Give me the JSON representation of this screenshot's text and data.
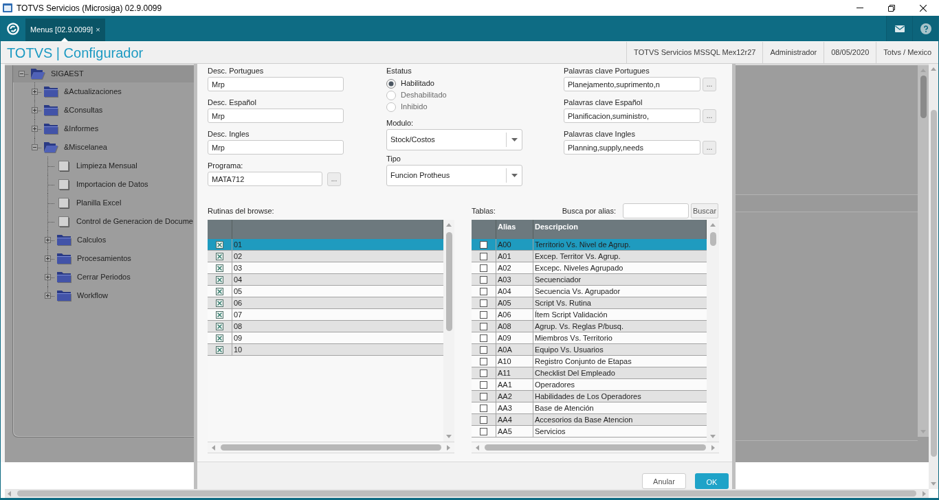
{
  "window": {
    "title": "TOTVS Servicios (Microsiga) 02.9.0099"
  },
  "tabs": [
    {
      "label": "Menus [02.9.0099]",
      "close": "×",
      "selected": true
    }
  ],
  "header": {
    "title": "TOTVS | Configurador",
    "info": [
      "TOTVS Servicios MSSQL Mex12r27",
      "Administrador",
      "08/05/2020",
      "Totvs / Mexico"
    ]
  },
  "menu_tree": [
    {
      "label": "SIGAEST",
      "kind": "folder",
      "expanded": true,
      "selected": true,
      "children": [
        {
          "label": "&Actualizaciones",
          "kind": "folder",
          "expanded": false,
          "selected": false
        },
        {
          "label": "&Consultas",
          "kind": "folder",
          "expanded": false,
          "selected": false
        },
        {
          "label": "&Informes",
          "kind": "folder",
          "expanded": false,
          "selected": false
        },
        {
          "label": "&Miscelanea",
          "kind": "folder",
          "expanded": true,
          "selected": false,
          "children": [
            {
              "label": "Limpieza Mensual",
              "kind": "item",
              "selected": false
            },
            {
              "label": "Importacion de Datos",
              "kind": "item",
              "selected": false
            },
            {
              "label": "Planilla Excel",
              "kind": "item",
              "selected": false
            },
            {
              "label": "Control de Generacion de Docume",
              "kind": "item",
              "selected": false
            },
            {
              "label": "Calculos",
              "kind": "folder",
              "expanded": false,
              "selected": false
            },
            {
              "label": "Procesamientos",
              "kind": "folder",
              "expanded": false,
              "selected": false
            },
            {
              "label": "Cerrar Periodos",
              "kind": "folder",
              "expanded": false,
              "selected": false
            },
            {
              "label": "Workflow",
              "kind": "folder",
              "expanded": false,
              "selected": false
            }
          ]
        }
      ]
    }
  ],
  "dialog": {
    "descriptions": [
      {
        "label": "Desc. Portugues",
        "value": "Mrp"
      },
      {
        "label": "Desc. Español",
        "value": "Mrp"
      },
      {
        "label": "Desc. Ingles",
        "value": "Mrp"
      }
    ],
    "program": {
      "label": "Programa:",
      "value": "MATA712",
      "button": "..."
    },
    "status": {
      "label": "Estatus",
      "options": [
        {
          "label": "Habilitado",
          "selected": true
        },
        {
          "label": "Deshabilitado",
          "selected": false
        },
        {
          "label": "Inhibido",
          "selected": false
        }
      ]
    },
    "module": {
      "label": "Modulo:",
      "value": "Stock/Costos"
    },
    "type": {
      "label": "Tipo",
      "value": "Funcion Protheus"
    },
    "keywords": [
      {
        "label": "Palavras clave Portugues",
        "value": "Planejamento,suprimento,n",
        "button": "..."
      },
      {
        "label": "Palavras clave Español",
        "value": "Planificacion,suministro,",
        "button": "..."
      },
      {
        "label": "Palavras clave Ingles",
        "value": "Planning,supply,needs",
        "button": "..."
      }
    ],
    "routines": {
      "label": "Rutinas del browse:",
      "rows": [
        {
          "value": "01",
          "checked": true,
          "selected": true
        },
        {
          "value": "02",
          "checked": true,
          "selected": false
        },
        {
          "value": "03",
          "checked": true,
          "selected": false
        },
        {
          "value": "04",
          "checked": true,
          "selected": false
        },
        {
          "value": "05",
          "checked": true,
          "selected": false
        },
        {
          "value": "06",
          "checked": true,
          "selected": false
        },
        {
          "value": "07",
          "checked": true,
          "selected": false
        },
        {
          "value": "08",
          "checked": true,
          "selected": false
        },
        {
          "value": "09",
          "checked": true,
          "selected": false
        },
        {
          "value": "10",
          "checked": true,
          "selected": false
        }
      ]
    },
    "tables": {
      "label": "Tablas:",
      "search_label": "Busca por alias:",
      "search_button": "Buscar",
      "columns": [
        "Alias",
        "Descripcion"
      ],
      "rows": [
        {
          "alias": "A00",
          "description": "Territorio Vs. Nivel de Agrup.",
          "checked": false,
          "selected": true
        },
        {
          "alias": "A01",
          "description": "Excep. Territor Vs. Agrup.",
          "checked": false,
          "selected": false
        },
        {
          "alias": "A02",
          "description": "Excepc. Niveles Agrupado",
          "checked": false,
          "selected": false
        },
        {
          "alias": "A03",
          "description": "Secuenciador",
          "checked": false,
          "selected": false
        },
        {
          "alias": "A04",
          "description": "Secuencia Vs. Agrupador",
          "checked": false,
          "selected": false
        },
        {
          "alias": "A05",
          "description": "Script Vs. Rutina",
          "checked": false,
          "selected": false
        },
        {
          "alias": "A06",
          "description": "Ítem Script Validación",
          "checked": false,
          "selected": false
        },
        {
          "alias": "A08",
          "description": "Agrup. Vs. Reglas P/busq.",
          "checked": false,
          "selected": false
        },
        {
          "alias": "A09",
          "description": "Miembros Vs. Territorio",
          "checked": false,
          "selected": false
        },
        {
          "alias": "A0A",
          "description": "Equipo Vs. Usuarios",
          "checked": false,
          "selected": false
        },
        {
          "alias": "A10",
          "description": "Registro Conjunto de Etapas",
          "checked": false,
          "selected": false
        },
        {
          "alias": "A11",
          "description": "Checklist Del Empleado",
          "checked": false,
          "selected": false
        },
        {
          "alias": "AA1",
          "description": "Operadores",
          "checked": false,
          "selected": false
        },
        {
          "alias": "AA2",
          "description": "Habilidades de Los Operadores",
          "checked": false,
          "selected": false
        },
        {
          "alias": "AA3",
          "description": "Base de Atención",
          "checked": false,
          "selected": false
        },
        {
          "alias": "AA4",
          "description": "Accesorios da Base Atencion",
          "checked": false,
          "selected": false
        },
        {
          "alias": "AA5",
          "description": "Servicios",
          "checked": false,
          "selected": false
        }
      ]
    },
    "buttons": [
      {
        "label": "Anular",
        "kind": "cancel"
      },
      {
        "label": "OK",
        "kind": "confirm"
      }
    ]
  }
}
